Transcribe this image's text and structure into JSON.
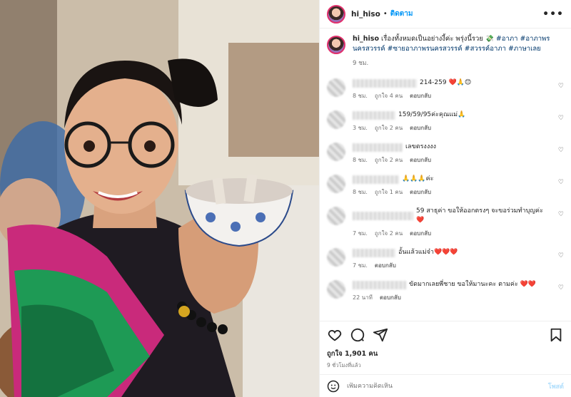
{
  "post": {
    "username": "hi_hiso",
    "dot": "•",
    "follow_label": "ติดตาม",
    "more_label": "•••"
  },
  "caption": {
    "username": "hi_hiso",
    "text": "เรื่องทั้งหมดเป็นอย่างงี้ค่ะ พรุ่งนี้รวย 💸",
    "hashtags": "#อาภา #อาภาพรนครสวรรค์ #ซายอาภาพรนครสวรรค์ #สวรรค์อาภา #ภาษาเลย",
    "time": "9 ชม."
  },
  "comments": [
    {
      "text": "214-259 ❤️🙏😊",
      "time": "8 ชม.",
      "likes": "ถูกใจ 4 คน",
      "reply": "ตอบกลับ"
    },
    {
      "text": "159/59/95ค่ะคุณแม่🙏",
      "time": "3 ชม.",
      "likes": "ถูกใจ 2 คน",
      "reply": "ตอบกลับ"
    },
    {
      "text": "เลขตรงงงง",
      "time": "8 ชม.",
      "likes": "ถูกใจ 2 คน",
      "reply": "ตอบกลับ"
    },
    {
      "text": "🙏🙏🙏ค่ะ",
      "time": "8 ชม.",
      "likes": "ถูกใจ 1 คน",
      "reply": "ตอบกลับ"
    },
    {
      "text": "59 สาธุค่า ขอให้ออกตรงๆ จะขอร่วมทำบุญค่ะ❤️",
      "time": "7 ชม.",
      "likes": "ถูกใจ 2 คน",
      "reply": "ตอบกลับ"
    },
    {
      "text": "อั้นแล้วแม่จ๋า❤️❤️❤️",
      "time": "7 ชม.",
      "likes": "",
      "reply": "ตอบกลับ"
    },
    {
      "text": "ขัดมากเลยพี่ชาย ขอให้มานะคะ ตามค่ะ ❤️❤️",
      "time": "22 นาที",
      "likes": "",
      "reply": "ตอบกลับ"
    }
  ],
  "footer": {
    "likes": "ถูกใจ 1,901 คน",
    "ago": "9 ชั่วโมงที่แล้ว",
    "comment_placeholder": "เพิ่มความคิดเห็น",
    "post_label": "โพสต์"
  },
  "colors": {
    "accent": "#0095f6",
    "heart": "#ed4956",
    "muted": "#737373"
  },
  "icons": [
    "heart-icon",
    "comment-icon",
    "share-icon",
    "bookmark-icon",
    "emoji-icon",
    "more-icon"
  ]
}
